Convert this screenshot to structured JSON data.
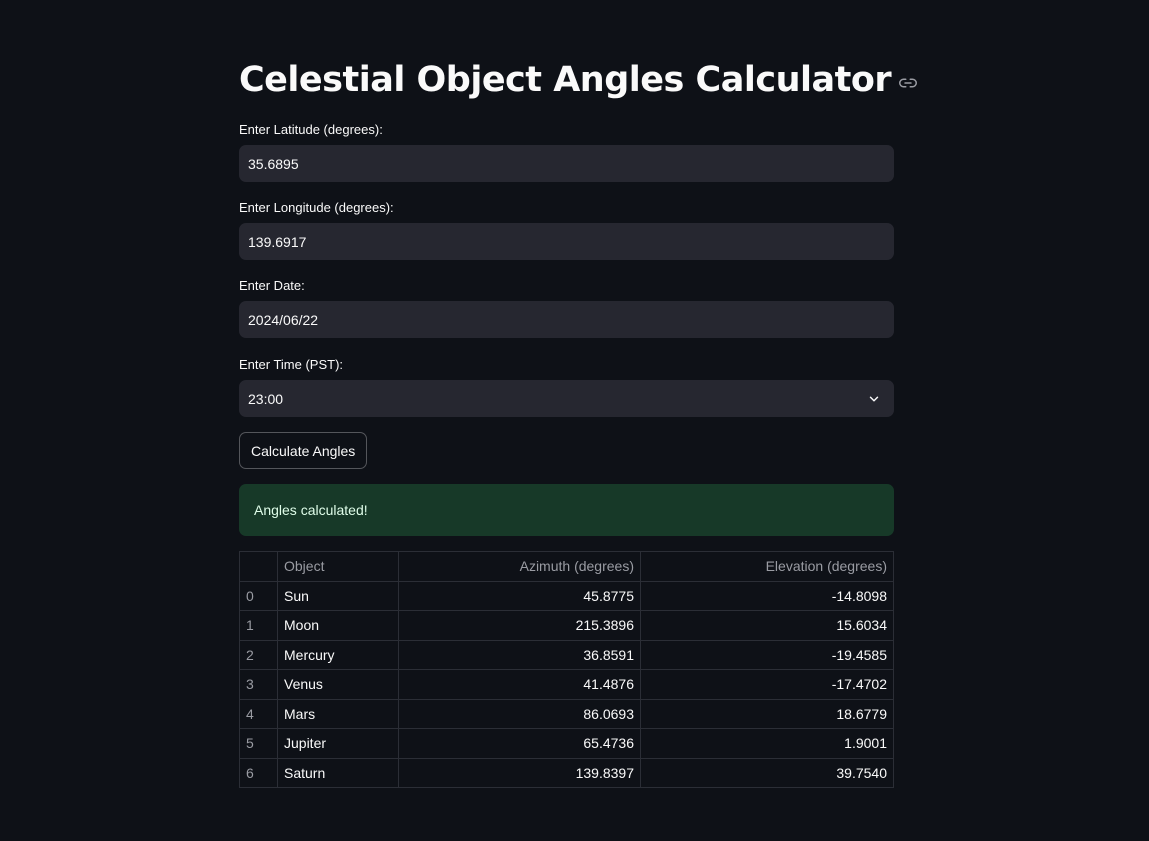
{
  "page": {
    "title": "Celestial Object Angles Calculator",
    "link_icon": "link-icon"
  },
  "fields": {
    "latitude": {
      "label": "Enter Latitude (degrees):",
      "value": "35.6895"
    },
    "longitude": {
      "label": "Enter Longitude (degrees):",
      "value": "139.6917"
    },
    "date": {
      "label": "Enter Date:",
      "value": "2024/06/22"
    },
    "time": {
      "label": "Enter Time (PST):",
      "value": "23:00",
      "icon": "chevron-down-icon"
    }
  },
  "button": {
    "label": "Calculate Angles"
  },
  "alert": {
    "text": "Angles calculated!",
    "color": "#173928"
  },
  "table": {
    "columns": [
      "",
      "Object",
      "Azimuth (degrees)",
      "Elevation (degrees)"
    ],
    "rows": [
      {
        "index": "0",
        "object": "Sun",
        "azimuth": "45.8775",
        "elevation": "-14.8098"
      },
      {
        "index": "1",
        "object": "Moon",
        "azimuth": "215.3896",
        "elevation": "15.6034"
      },
      {
        "index": "2",
        "object": "Mercury",
        "azimuth": "36.8591",
        "elevation": "-19.4585"
      },
      {
        "index": "3",
        "object": "Venus",
        "azimuth": "41.4876",
        "elevation": "-17.4702"
      },
      {
        "index": "4",
        "object": "Mars",
        "azimuth": "86.0693",
        "elevation": "18.6779"
      },
      {
        "index": "5",
        "object": "Jupiter",
        "azimuth": "65.4736",
        "elevation": "1.9001"
      },
      {
        "index": "6",
        "object": "Saturn",
        "azimuth": "139.8397",
        "elevation": "39.7540"
      }
    ]
  },
  "colors": {
    "background": "#0e1117",
    "input_bg": "#262730",
    "text": "#fafafa",
    "success_bg": "#173928",
    "success_text": "#dffde9"
  }
}
